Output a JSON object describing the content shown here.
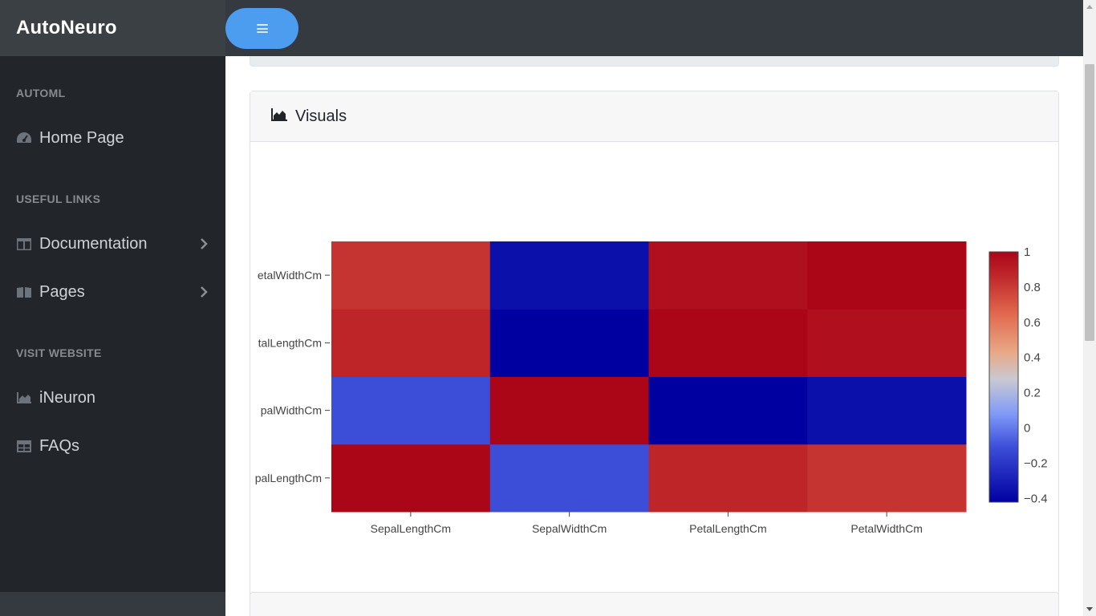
{
  "app": {
    "brand": "AutoNeuro"
  },
  "sidebar": {
    "sections": [
      {
        "heading": "AUTOML"
      },
      {
        "heading": "USEFUL LINKS"
      },
      {
        "heading": "VISIT WEBSITE"
      }
    ],
    "items": [
      {
        "label": "Home Page",
        "icon": "tachometer-icon"
      },
      {
        "label": "Documentation",
        "icon": "columns-icon",
        "has_submenu": true
      },
      {
        "label": "Pages",
        "icon": "book-icon",
        "has_submenu": true
      },
      {
        "label": "iNeuron",
        "icon": "area-chart-icon"
      },
      {
        "label": "FAQs",
        "icon": "table-icon"
      }
    ]
  },
  "main": {
    "visuals_card": {
      "title": "Visuals",
      "icon": "area-chart-icon"
    }
  },
  "colors": {
    "topbar": "#343a40",
    "sidebar": "#222529",
    "menu_button": "#4c9cf0"
  },
  "chart_data": {
    "type": "heatmap",
    "x": [
      "SepalLengthCm",
      "SepalWidthCm",
      "PetalLengthCm",
      "PetalWidthCm"
    ],
    "y": [
      "SepalLengthCm",
      "SepalWidthCm",
      "PetalLengthCm",
      "PetalWidthCm"
    ],
    "z": [
      [
        1.0,
        -0.109,
        0.872,
        0.818
      ],
      [
        -0.109,
        1.0,
        -0.421,
        -0.357
      ],
      [
        0.872,
        -0.421,
        1.0,
        0.963
      ],
      [
        0.818,
        -0.357,
        0.963,
        1.0
      ]
    ],
    "y_tick_labels_visible": [
      "palLengthCm",
      "palWidthCm",
      "talLengthCm",
      "etalWidthCm"
    ],
    "colorscale": "coolwarm",
    "zmin": -0.421,
    "zmax": 1.0,
    "colorbar_ticks": [
      "1",
      "0.8",
      "0.6",
      "0.4",
      "0.2",
      "0",
      "−0.2",
      "−0.4"
    ],
    "colorbar_tick_values": [
      1,
      0.8,
      0.6,
      0.4,
      0.2,
      0,
      -0.2,
      -0.4
    ]
  }
}
